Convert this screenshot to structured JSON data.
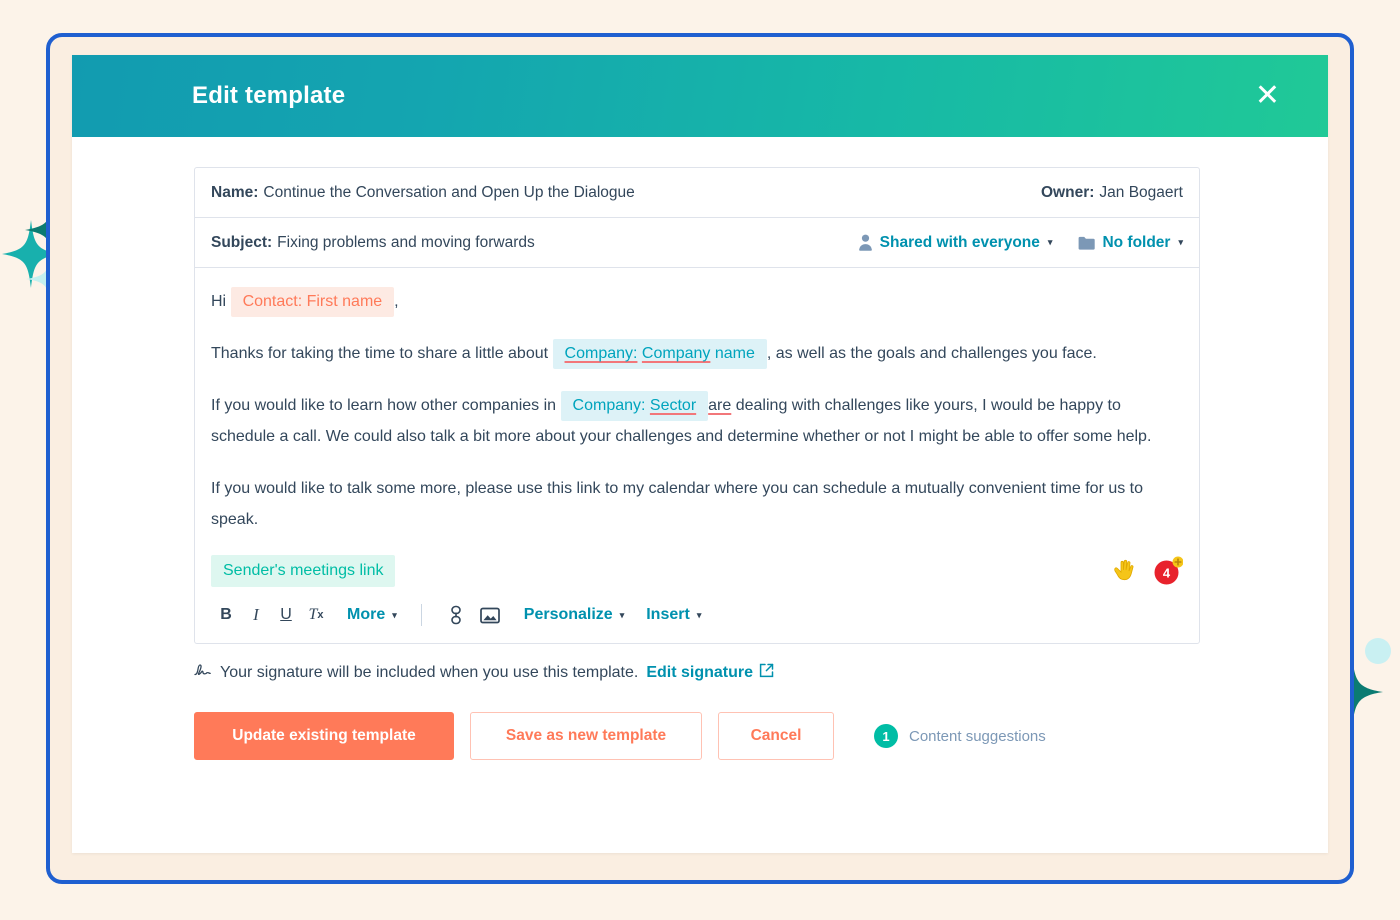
{
  "window": {
    "background_color": "#fcf3e9",
    "frame_border_color": "#1f5fd0",
    "inner_panel_color": "#faeee1"
  },
  "header": {
    "title": "Edit template",
    "close_icon": "close-icon",
    "gradient_from": "#129bb0",
    "gradient_to": "#20c997"
  },
  "meta": {
    "name_label": "Name:",
    "name_value": "Continue the Conversation and Open Up the Dialogue",
    "owner_label": "Owner:",
    "owner_value": "Jan Bogaert",
    "subject_label": "Subject:",
    "subject_value": "Fixing problems and moving forwards",
    "sharing_label": "Shared with everyone",
    "sharing_icon": "person-icon",
    "folder_label": "No folder",
    "folder_icon": "folder-icon",
    "caret": "▾"
  },
  "email": {
    "greeting_prefix": "Hi",
    "token_first_name": "Contact: First name",
    "greeting_suffix": ",",
    "p2_before": "Thanks for taking the time to share a little about",
    "token_company_a": "Company:",
    "token_company_b": "Company",
    "token_company_c": "name",
    "p2_after": ", as well as the goals and challenges you face.",
    "p3_before": "If you would like to learn how other companies in",
    "token_sector_a": "Company:",
    "token_sector_b": "Sector",
    "p3_are": "are",
    "p3_after": "dealing with challenges like yours, I would be happy to schedule a call. We could also talk a bit more about your challenges and determine whether or not I might be able to offer some help.",
    "p4": "If you would like to talk some more, please use this link to my calendar where you can schedule a mutually convenient time for us to speak.",
    "token_meetings_link": "Sender's meetings link",
    "token_contact_bg": "#fdeae3",
    "token_contact_fg": "#ff7a59",
    "token_company_bg": "#ddf2f7",
    "token_company_fg": "#00a4bd",
    "token_meetings_bg": "#def7f0",
    "token_meetings_fg": "#00bda5",
    "spellcheck_underline_color": "#f2777a"
  },
  "editor_badges": {
    "hand_icon": "hand-icon",
    "count_badge": "4",
    "count_badge_color": "#e8222c",
    "plus_badge": "+",
    "plus_badge_color": "#f5c518"
  },
  "toolbar": {
    "bold": "B",
    "italic": "I",
    "underline": "U",
    "clear_format": "T",
    "clear_format_sub": "x",
    "more_label": "More",
    "link_icon": "link-icon",
    "image_icon": "image-icon",
    "personalize_label": "Personalize",
    "insert_label": "Insert",
    "caret": "▾",
    "accent_color": "#0091ae"
  },
  "signature": {
    "icon": "signature-icon",
    "text": "Your signature will be included when you use this template.",
    "link_label": "Edit signature",
    "link_icon": "external-link-icon"
  },
  "footer": {
    "primary_label": "Update existing template",
    "secondary_label": "Save as new template",
    "tertiary_label": "Cancel",
    "suggestions_count": "1",
    "suggestions_label": "Content suggestions",
    "primary_color": "#ff7a59",
    "badge_color": "#00bda5"
  },
  "decorations": {
    "sparkle_teal": "#18b0ad",
    "sparkle_dark": "#0b7b72",
    "sparkle_light": "#c3f0ef",
    "dot_light": "#c9f0f2"
  }
}
